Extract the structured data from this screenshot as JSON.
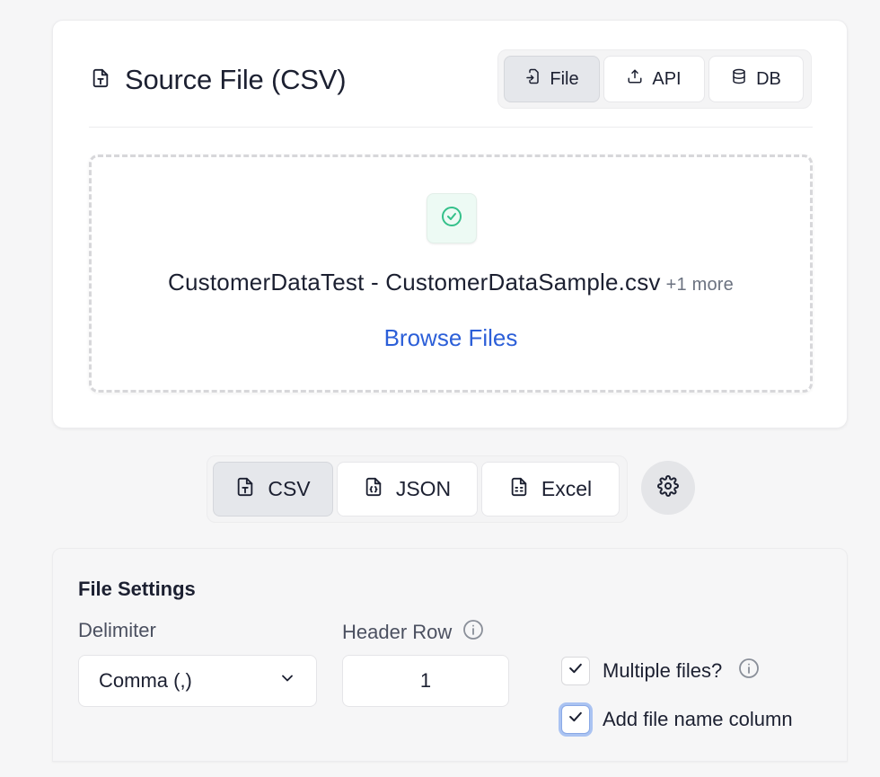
{
  "source_card": {
    "title": "Source File (CSV)",
    "tabs": [
      {
        "label": "File",
        "icon": "file-import-icon",
        "active": true
      },
      {
        "label": "API",
        "icon": "upload-icon",
        "active": false
      },
      {
        "label": "DB",
        "icon": "database-icon",
        "active": false
      }
    ],
    "dropzone": {
      "file_name": "CustomerDataTest - CustomerDataSample.csv",
      "more_label": "+1 more",
      "browse_label": "Browse Files",
      "status_icon": "check-circle-icon"
    }
  },
  "format_tabs": [
    {
      "label": "CSV",
      "icon": "file-text-icon",
      "active": true
    },
    {
      "label": "JSON",
      "icon": "file-code-icon",
      "active": false
    },
    {
      "label": "Excel",
      "icon": "file-spreadsheet-icon",
      "active": false
    }
  ],
  "settings_icon": "gear-icon",
  "file_settings": {
    "title": "File Settings",
    "delimiter_label": "Delimiter",
    "delimiter_value": "Comma (,)",
    "header_row_label": "Header Row",
    "header_row_value": "1",
    "multiple_files_label": "Multiple files?",
    "multiple_files_checked": true,
    "add_filename_label": "Add file name column",
    "add_filename_checked": true
  },
  "colors": {
    "accent": "#2c5fd8",
    "success": "#34c08a",
    "text": "#1c2031"
  }
}
